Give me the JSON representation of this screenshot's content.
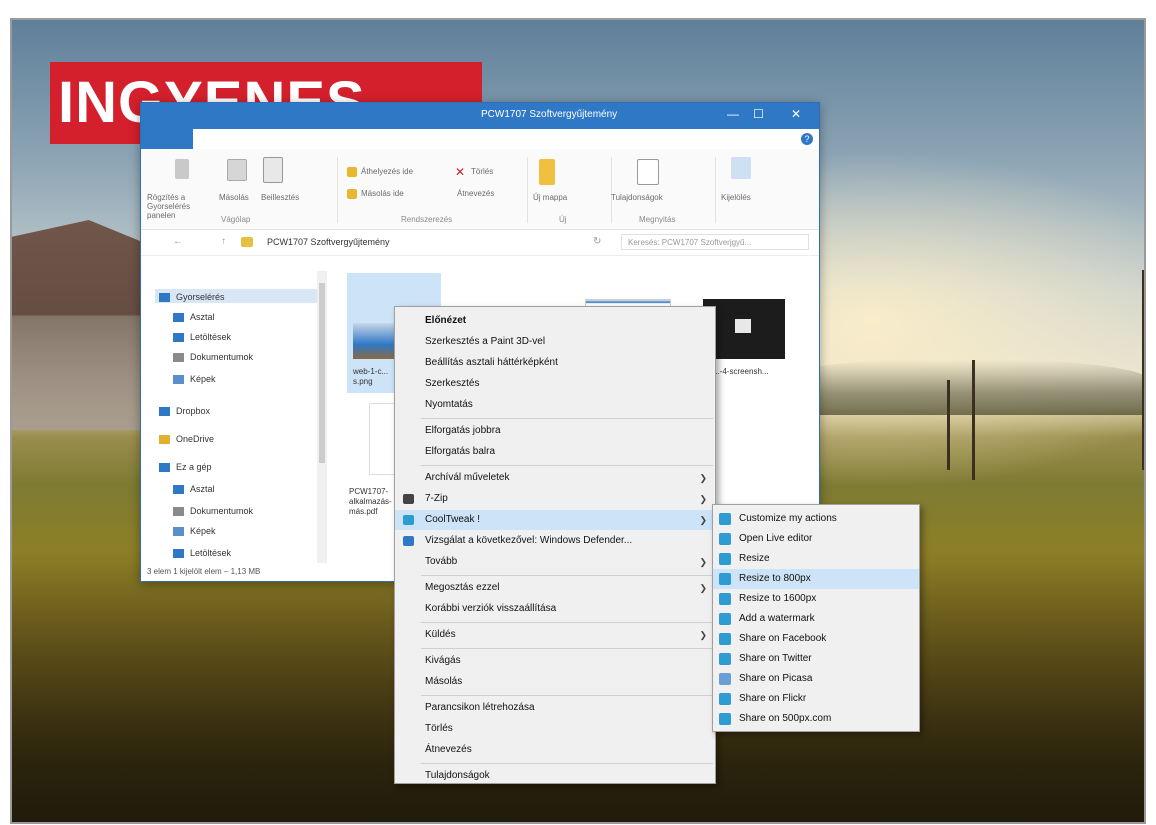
{
  "banner": {
    "text": "INGYENES"
  },
  "window": {
    "title": "PCW1707 Szoftvergyűjtemény",
    "path": "PCW1707 Szoftvergyűjtemény",
    "search_placeholder": "Keresés: PCW1707 Szoftverjgyű...",
    "status": "3 elem    1 kijelölt elem – 1,13 MB"
  },
  "ribbon": {
    "items": [
      "Rögzítés a Gyorselérés panelen",
      "Másolás",
      "Beillesztés",
      "Áthelyezés ide",
      "Törlés",
      "Másolás ide",
      "Átnevezés",
      "Új mappa",
      "Tulajdonságok",
      "Kijelölés"
    ],
    "groups": [
      "Vágólap",
      "Rendszerezés",
      "Új",
      "Megnyitás"
    ]
  },
  "nav": {
    "items": [
      {
        "label": "Gyorselérés",
        "icon": "star-icon",
        "color": "#2f78c5"
      },
      {
        "label": "Asztal",
        "icon": "desktop-icon",
        "color": "#2f78c5"
      },
      {
        "label": "Letöltések",
        "icon": "download-icon",
        "color": "#2f78c5"
      },
      {
        "label": "Dokumentumok",
        "icon": "document-icon",
        "color": "#8a8a8a"
      },
      {
        "label": "Képek",
        "icon": "picture-icon",
        "color": "#5b8fc7"
      },
      {
        "label": "Dropbox",
        "icon": "dropbox-icon",
        "color": "#2f78c5"
      },
      {
        "label": "OneDrive",
        "icon": "onedrive-icon",
        "color": "#e0b030"
      },
      {
        "label": "Ez a gép",
        "icon": "computer-icon",
        "color": "#2f78c5"
      },
      {
        "label": "Asztal",
        "icon": "desktop-icon",
        "color": "#2f78c5"
      },
      {
        "label": "Dokumentumok",
        "icon": "document-icon",
        "color": "#8a8a8a"
      },
      {
        "label": "Képek",
        "icon": "picture-icon",
        "color": "#5b8fc7"
      },
      {
        "label": "Letöltések",
        "icon": "download-icon",
        "color": "#2f78c5"
      }
    ]
  },
  "files": [
    {
      "label": "web-1-c... s.png"
    },
    {
      "label": "PCW1707-alkalmazás-más.pdf"
    },
    {
      "label": "...-4-screensh..."
    }
  ],
  "context_menu": {
    "items": [
      {
        "label": "Előnézet",
        "bold": true
      },
      {
        "label": "Szerkesztés a Paint 3D-vel"
      },
      {
        "label": "Beállítás asztali háttérképként"
      },
      {
        "label": "Szerkesztés"
      },
      {
        "label": "Nyomtatás"
      },
      {
        "label": "Elforgatás jobbra"
      },
      {
        "label": "Elforgatás balra"
      },
      {
        "label": "Archívál műveletek",
        "submenu": true
      },
      {
        "label": "7-Zip",
        "submenu": true,
        "icon_color": "#444444"
      },
      {
        "label": "CoolTweak !",
        "submenu": true,
        "highlight": true,
        "icon_color": "#2f9bd3"
      },
      {
        "label": "Vizsgálat a következővel: Windows Defender...",
        "icon_color": "#2f78c5"
      },
      {
        "label": "Tovább",
        "submenu": true
      },
      {
        "label": "Megosztás ezzel",
        "submenu": true
      },
      {
        "label": "Korábbi verziók visszaállítása"
      },
      {
        "label": "Küldés",
        "submenu": true
      },
      {
        "label": "Kivágás"
      },
      {
        "label": "Másolás"
      },
      {
        "label": "Parancsikon létrehozása"
      },
      {
        "label": "Törlés"
      },
      {
        "label": "Átnevezés"
      },
      {
        "label": "Tulajdonságok"
      }
    ]
  },
  "submenu": {
    "items": [
      {
        "label": "Customize my actions",
        "icon_color": "#2f9bd3"
      },
      {
        "label": "Open Live editor",
        "icon_color": "#2f9bd3"
      },
      {
        "label": "Resize",
        "icon_color": "#2f9bd3"
      },
      {
        "label": "Resize to 800px",
        "icon_color": "#2f9bd3",
        "highlight": true
      },
      {
        "label": "Resize to 1600px",
        "icon_color": "#2f9bd3"
      },
      {
        "label": "Add a watermark",
        "icon_color": "#2f9bd3"
      },
      {
        "label": "Share on Facebook",
        "icon_color": "#2f9bd3"
      },
      {
        "label": "Share on Twitter",
        "icon_color": "#2f9bd3"
      },
      {
        "label": "Share on Picasa",
        "icon_color": "#6a9fd6"
      },
      {
        "label": "Share on Flickr",
        "icon_color": "#2f9bd3"
      },
      {
        "label": "Share on 500px.com",
        "icon_color": "#2f9bd3"
      }
    ]
  }
}
